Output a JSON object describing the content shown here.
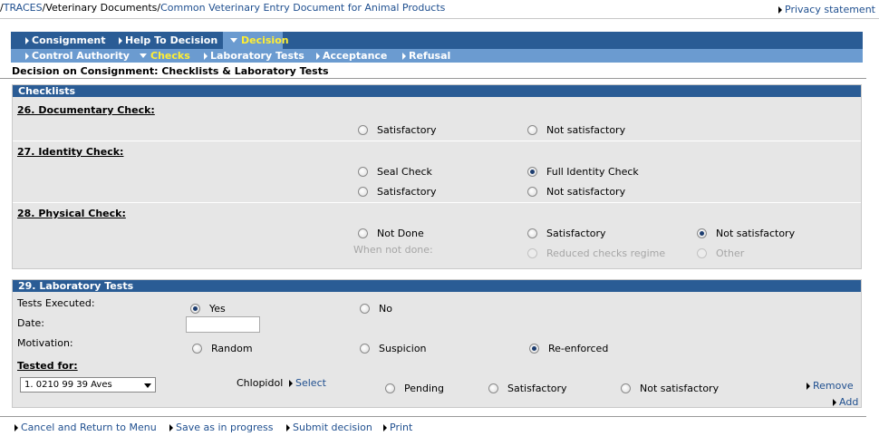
{
  "breadcrumb": {
    "root": "TRACES",
    "section": "Veterinary Documents",
    "current": "Common Veterinary Entry Document for Animal Products"
  },
  "privacy_link": "Privacy statement",
  "nav": {
    "primary": [
      "Consignment",
      "Help To Decision",
      "Decision"
    ],
    "secondary": [
      "Control Authority",
      "Checks",
      "Laboratory Tests",
      "Acceptance",
      "Refusal"
    ],
    "active_primary": "Decision",
    "active_secondary": "Checks"
  },
  "page_title": "Decision on Consignment: Checklists & Laboratory Tests",
  "checklists": {
    "header": "Checklists",
    "documentary": {
      "label": "26. Documentary Check:",
      "options": [
        "Satisfactory",
        "Not satisfactory"
      ],
      "selected": null
    },
    "identity": {
      "label": "27. Identity Check:",
      "type_options": [
        "Seal Check",
        "Full Identity Check"
      ],
      "type_selected": "Full Identity Check",
      "result_options": [
        "Satisfactory",
        "Not satisfactory"
      ],
      "result_selected": null
    },
    "physical": {
      "label": "28. Physical Check:",
      "options": [
        "Not Done",
        "Satisfactory",
        "Not satisfactory"
      ],
      "selected": "Not satisfactory",
      "when_not_done_label": "When not done:",
      "when_not_done_options": [
        "Reduced checks regime",
        "Other"
      ]
    }
  },
  "lab_tests": {
    "header": "29. Laboratory Tests",
    "tests_executed_label": "Tests Executed:",
    "tests_executed_options": [
      "Yes",
      "No"
    ],
    "tests_executed_selected": "Yes",
    "date_label": "Date:",
    "date_value": "",
    "motivation_label": "Motivation:",
    "motivation_options": [
      "Random",
      "Suspicion",
      "Re-enforced"
    ],
    "motivation_selected": "Re-enforced",
    "tested_for_label": "Tested for:",
    "tested_for_value": "1. 0210 99 39 Aves",
    "substance": "Chlopidol",
    "select_link": "Select",
    "result_options": [
      "Pending",
      "Satisfactory",
      "Not satisfactory"
    ],
    "result_selected": null,
    "remove_link": "Remove",
    "add_link": "Add"
  },
  "footer": {
    "actions": [
      "Cancel and Return to Menu",
      "Save as in progress",
      "Submit decision",
      "Print"
    ]
  },
  "colors": {
    "nav_dark": "#2a5c95",
    "nav_light": "#6b9bd0",
    "active_text": "#ffee33",
    "panel_bg": "#e6e6e6",
    "link": "#1f4f8f"
  }
}
